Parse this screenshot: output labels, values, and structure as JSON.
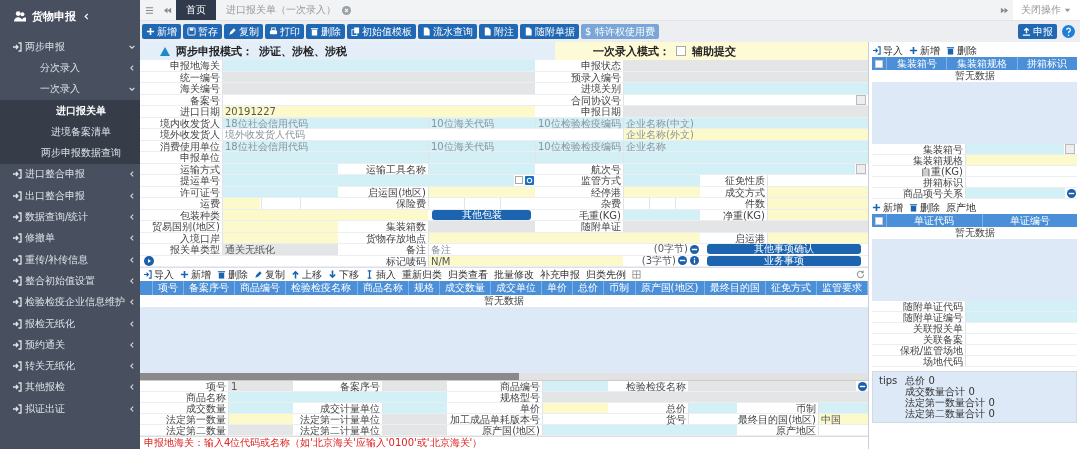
{
  "sidebar": {
    "header": {
      "label": "货物申报"
    },
    "items": [
      {
        "label": "两步申报",
        "expanded": true,
        "selected": false,
        "children": [
          {
            "label": "分次录入",
            "expanded": false,
            "selected": false
          },
          {
            "label": "一次录入",
            "expanded": true,
            "selected": false,
            "children": [
              {
                "label": "进口报关单",
                "selected": true
              },
              {
                "label": "进境备案清单",
                "selected": false
              },
              {
                "label": "两步申报数据查询",
                "selected": false
              }
            ]
          }
        ]
      },
      {
        "label": "进口整合申报",
        "expanded": false,
        "selected": false
      },
      {
        "label": "出口整合申报",
        "expanded": false,
        "selected": false
      },
      {
        "label": "数据查询/统计",
        "expanded": false,
        "selected": false
      },
      {
        "label": "修撤单",
        "expanded": false,
        "selected": false
      },
      {
        "label": "重传/补传信息",
        "expanded": false,
        "selected": false
      },
      {
        "label": "整合初始值设置",
        "expanded": false,
        "selected": false
      },
      {
        "label": "检验检疫企业信息维护",
        "expanded": false,
        "selected": false
      },
      {
        "label": "报检无纸化",
        "expanded": false,
        "selected": false
      },
      {
        "label": "预约通关",
        "expanded": false,
        "selected": false
      },
      {
        "label": "转关无纸化",
        "expanded": false,
        "selected": false
      },
      {
        "label": "其他报检",
        "expanded": false,
        "selected": false
      },
      {
        "label": "拟证出证",
        "expanded": false,
        "selected": false
      }
    ]
  },
  "tabs": [
    {
      "label": "首页",
      "selected": true,
      "closable": false
    },
    {
      "label": "进口报关单（一次录入）",
      "selected": false,
      "closable": true
    }
  ],
  "close_menu": "关闭操作",
  "toolbar": [
    {
      "label": "新增",
      "disabled": false
    },
    {
      "label": "暂存",
      "disabled": false
    },
    {
      "label": "复制",
      "disabled": false
    },
    {
      "label": "打印",
      "disabled": false
    },
    {
      "label": "删除",
      "disabled": false
    },
    {
      "label": "初始值模板",
      "disabled": false
    },
    {
      "label": "流水查询",
      "disabled": false
    },
    {
      "label": "附注",
      "disabled": false
    },
    {
      "label": "随附单据",
      "disabled": false
    },
    {
      "label": "$ 特许权使用费",
      "disabled": true
    }
  ],
  "submit_button": "申报",
  "form": {
    "banner": {
      "mode": "两步申报模式：",
      "scope": "涉证、涉检、涉税",
      "once_mode": "一次录入模式：",
      "assist": {
        "label": "辅助提交",
        "checked": false
      }
    },
    "rows": [
      [
        {
          "kind": "label",
          "text": "申报地海关"
        },
        {
          "kind": "input",
          "field": {
            "kind": "required"
          }
        },
        {
          "kind": "label",
          "text": "申报状态"
        },
        {
          "kind": "input",
          "field": {
            "kind": "readonly"
          }
        }
      ],
      [
        {
          "kind": "label",
          "text": "统一编号"
        },
        {
          "kind": "input",
          "field": {
            "kind": "readonly"
          }
        },
        {
          "kind": "label",
          "text": "预录入编号"
        },
        {
          "kind": "input",
          "field": {
            "kind": "readonly"
          }
        }
      ],
      [
        {
          "kind": "label",
          "text": "海关编号"
        },
        {
          "kind": "input",
          "field": {
            "kind": "readonly"
          }
        },
        {
          "kind": "label",
          "text": "进境关别"
        },
        {
          "kind": "input",
          "field": {
            "kind": "required"
          }
        }
      ],
      [
        {
          "kind": "label",
          "text": "备案号"
        },
        {
          "kind": "input",
          "field": {
            "kind": "plain"
          }
        },
        {
          "kind": "label",
          "text": "合同协议号"
        },
        {
          "kind": "picker",
          "field": {
            "kind": "plain"
          }
        }
      ],
      [
        {
          "kind": "label",
          "text": "进口日期"
        },
        {
          "kind": "input",
          "field": {
            "kind": "highlight",
            "value": "20191227"
          }
        },
        {
          "kind": "label",
          "text": "申报日期"
        },
        {
          "kind": "input",
          "field": {
            "kind": "readonly"
          }
        }
      ],
      [
        {
          "kind": "label",
          "text": "境内收发货人"
        },
        {
          "kind": "input",
          "field": {
            "kind": "required",
            "placeholder": "18位社会信用代码"
          }
        },
        {
          "kind": "input",
          "field": {
            "kind": "required",
            "placeholder": "10位海关代码"
          }
        },
        {
          "kind": "input",
          "field": {
            "kind": "required",
            "placeholder": "10位检验检疫编码"
          }
        },
        {
          "kind": "input",
          "field": {
            "kind": "required",
            "placeholder": "企业名称(中文)"
          }
        }
      ],
      [
        {
          "kind": "label",
          "text": "境外收发货人"
        },
        {
          "kind": "input",
          "field": {
            "kind": "plain",
            "placeholder": "境外收发货人代码"
          }
        },
        {
          "kind": "input",
          "field": {
            "kind": "highlight",
            "placeholder": "企业名称(外文)"
          }
        }
      ],
      [
        {
          "kind": "label",
          "text": "消费使用单位"
        },
        {
          "kind": "input",
          "field": {
            "kind": "required",
            "placeholder": "18位社会信用代码"
          }
        },
        {
          "kind": "input",
          "field": {
            "kind": "required",
            "placeholder": "10位海关代码"
          }
        },
        {
          "kind": "input",
          "field": {
            "kind": "required",
            "placeholder": "10位检验检疫编码"
          }
        },
        {
          "kind": "input",
          "field": {
            "kind": "required",
            "placeholder": "企业名称"
          }
        }
      ],
      [
        {
          "kind": "label",
          "text": "申报单位"
        },
        {
          "kind": "input",
          "field": {
            "kind": "required"
          }
        },
        {
          "kind": "input",
          "field": {
            "kind": "required"
          }
        },
        {
          "kind": "input",
          "field": {
            "kind": "required"
          }
        },
        {
          "kind": "input",
          "field": {
            "kind": "required"
          }
        }
      ],
      [
        {
          "kind": "label",
          "text": "运输方式"
        },
        {
          "kind": "input",
          "field": {
            "kind": "required"
          }
        },
        {
          "kind": "label",
          "text": "运输工具名称"
        },
        {
          "kind": "input",
          "field": {
            "kind": "required"
          }
        },
        {
          "kind": "label",
          "text": "航次号"
        },
        {
          "kind": "picker",
          "field": {
            "kind": "required"
          }
        }
      ],
      [
        {
          "kind": "label",
          "text": "提运单号"
        },
        {
          "kind": "check-input",
          "checked": false,
          "field": {
            "kind": "required"
          }
        },
        {
          "kind": "label",
          "text": "监管方式"
        },
        {
          "kind": "input",
          "field": {
            "kind": "required"
          }
        },
        {
          "kind": "label",
          "text": "征免性质"
        },
        {
          "kind": "input",
          "field": {
            "kind": "plain"
          }
        }
      ],
      [
        {
          "kind": "label",
          "text": "许可证号"
        },
        {
          "kind": "input",
          "field": {
            "kind": "required"
          }
        },
        {
          "kind": "label",
          "text": "启运国(地区)"
        },
        {
          "kind": "input",
          "field": {
            "kind": "highlight"
          }
        },
        {
          "kind": "label",
          "text": "经停港"
        },
        {
          "kind": "input",
          "field": {
            "kind": "highlight"
          }
        },
        {
          "kind": "label",
          "text": "成交方式"
        },
        {
          "kind": "input",
          "field": {
            "kind": "highlight"
          }
        }
      ],
      [
        {
          "kind": "label",
          "text": "运费"
        },
        {
          "kind": "split",
          "parts": [
            {
              "kind": "highlight"
            },
            {
              "kind": "plain"
            },
            {
              "kind": "plain"
            }
          ]
        },
        {
          "kind": "label",
          "text": "保险费"
        },
        {
          "kind": "split",
          "parts": [
            {
              "kind": "plain"
            },
            {
              "kind": "plain"
            },
            {
              "kind": "plain"
            }
          ]
        },
        {
          "kind": "label",
          "text": "杂费"
        },
        {
          "kind": "split",
          "parts": [
            {
              "kind": "plain"
            },
            {
              "kind": "plain"
            },
            {
              "kind": "plain"
            }
          ]
        },
        {
          "kind": "label",
          "text": "件数"
        },
        {
          "kind": "input",
          "field": {
            "kind": "highlight"
          }
        }
      ],
      [
        {
          "kind": "label",
          "text": "包装种类"
        },
        {
          "kind": "input",
          "field": {
            "kind": "highlight"
          }
        },
        {
          "kind": "button",
          "text": "其他包装"
        },
        {
          "kind": "label",
          "text": "毛重(KG)"
        },
        {
          "kind": "input",
          "field": {
            "kind": "required"
          }
        },
        {
          "kind": "label",
          "text": "净重(KG)"
        },
        {
          "kind": "input",
          "field": {
            "kind": "highlight"
          }
        }
      ],
      [
        {
          "kind": "label",
          "text": "贸易国别(地区)"
        },
        {
          "kind": "input",
          "field": {
            "kind": "highlight"
          }
        },
        {
          "kind": "label",
          "text": "集装箱数"
        },
        {
          "kind": "input",
          "field": {
            "kind": "readonly"
          }
        },
        {
          "kind": "label",
          "text": "随附单证"
        },
        {
          "kind": "input",
          "field": {
            "kind": "readonly"
          }
        }
      ],
      [
        {
          "kind": "label",
          "text": "入境口岸"
        },
        {
          "kind": "input",
          "field": {
            "kind": "highlight"
          }
        },
        {
          "kind": "label",
          "text": "货物存放地点"
        },
        {
          "kind": "input",
          "field": {
            "kind": "highlight"
          }
        },
        {
          "kind": "label",
          "text": "启运港"
        },
        {
          "kind": "input",
          "field": {
            "kind": "highlight"
          }
        }
      ],
      [
        {
          "kind": "label",
          "text": "报关单类型"
        },
        {
          "kind": "input",
          "field": {
            "kind": "readonly",
            "value": "通关无纸化"
          }
        },
        {
          "kind": "label",
          "text": "备注"
        },
        {
          "kind": "input",
          "field": {
            "kind": "plain",
            "placeholder": "备注"
          }
        },
        {
          "kind": "note",
          "text": "(0字节)"
        },
        {
          "kind": "button",
          "text": "其他事项确认"
        }
      ],
      [
        {
          "kind": "play"
        },
        {
          "kind": "blank"
        },
        {
          "kind": "label",
          "text": "标记唛码"
        },
        {
          "kind": "input",
          "field": {
            "kind": "highlight",
            "value": "N/M"
          }
        },
        {
          "kind": "note-info",
          "text": "(3字节)"
        },
        {
          "kind": "button",
          "text": "业务事项"
        }
      ]
    ]
  },
  "goods_toolbar": [
    "导入",
    "新增",
    "删除",
    "复制",
    "上移",
    "下移",
    "插入",
    "重新归类",
    "归类查看",
    "批量修改",
    "补充申报",
    "归类先例"
  ],
  "goods_table": {
    "columns": [
      "项号",
      "备案序号",
      "商品编号",
      "检验检疫名称",
      "商品名称",
      "规格",
      "成交数量",
      "成交单位",
      "单价",
      "总价",
      "币制",
      "原产国(地区)",
      "最终目的国",
      "征免方式",
      "监管要求"
    ],
    "empty_text": "暂无数据"
  },
  "item_form": {
    "fields": [
      {
        "kind": "label",
        "text": "项号"
      },
      {
        "kind": "input",
        "field": {
          "kind": "readonly",
          "value": "1"
        }
      },
      {
        "kind": "label",
        "text": "备案序号"
      },
      {
        "kind": "input",
        "field": {
          "kind": "readonly"
        }
      },
      {
        "kind": "label",
        "text": "商品编号"
      },
      {
        "kind": "input",
        "field": {
          "kind": "required"
        }
      },
      {
        "kind": "label",
        "text": "检验检疫名称"
      },
      {
        "kind": "lookup",
        "field": {
          "kind": "readonly"
        }
      },
      {
        "kind": "label",
        "text": "商品名称"
      },
      {
        "kind": "input",
        "field": {
          "kind": "required"
        }
      },
      {
        "kind": "label",
        "text": "规格型号"
      },
      {
        "kind": "input",
        "field": {
          "kind": "readonly"
        }
      },
      {
        "kind": "label",
        "text": "成交数量"
      },
      {
        "kind": "input",
        "field": {
          "kind": "required"
        }
      },
      {
        "kind": "label",
        "text": "成交计量单位"
      },
      {
        "kind": "input",
        "field": {
          "kind": "required"
        }
      },
      {
        "kind": "label",
        "text": "单价"
      },
      {
        "kind": "input",
        "field": {
          "kind": "highlight"
        }
      },
      {
        "kind": "label",
        "text": "总价"
      },
      {
        "kind": "input",
        "field": {
          "kind": "required"
        }
      },
      {
        "kind": "label",
        "text": "币制"
      },
      {
        "kind": "input",
        "field": {
          "kind": "required"
        }
      },
      {
        "kind": "label",
        "text": "法定第一数量"
      },
      {
        "kind": "input",
        "field": {
          "kind": "highlight"
        }
      },
      {
        "kind": "label",
        "text": "法定第一计量单位"
      },
      {
        "kind": "input",
        "field": {
          "kind": "readonly"
        }
      },
      {
        "kind": "label",
        "text": "加工成品单耗版本号"
      },
      {
        "kind": "input",
        "field": {
          "kind": "plain"
        }
      },
      {
        "kind": "label",
        "text": "货号"
      },
      {
        "kind": "input",
        "field": {
          "kind": "plain"
        }
      },
      {
        "kind": "label",
        "text": "最终目的国(地区)"
      },
      {
        "kind": "input",
        "field": {
          "kind": "highlight",
          "value": "中国"
        }
      },
      {
        "kind": "label",
        "text": "法定第二数量"
      },
      {
        "kind": "input",
        "field": {
          "kind": "readonly"
        }
      },
      {
        "kind": "label",
        "text": "法定第二计量单位"
      },
      {
        "kind": "input",
        "field": {
          "kind": "readonly"
        }
      },
      {
        "kind": "label",
        "text": "原产国(地区)"
      },
      {
        "kind": "input",
        "field": {
          "kind": "required"
        }
      },
      {
        "kind": "label",
        "text": "原产地区"
      },
      {
        "kind": "input",
        "field": {
          "kind": "plain"
        }
      }
    ]
  },
  "status_hint": "申报地海关：输入4位代码或名称（如'北京海关'应输入'0100'或'北京海关'）",
  "container_panel": {
    "toolbar": [
      "导入",
      "新增",
      "删除"
    ],
    "select_all": {
      "checked": false
    },
    "columns": [
      "集装箱号",
      "集装箱规格",
      "拼箱标识"
    ],
    "empty_text": "暂无数据",
    "fields": [
      [
        {
          "kind": "label",
          "text": "集装箱号"
        },
        {
          "kind": "picker",
          "field": {
            "kind": "required"
          }
        }
      ],
      [
        {
          "kind": "label",
          "text": "集装箱规格"
        },
        {
          "kind": "input",
          "field": {
            "kind": "highlight"
          }
        }
      ],
      [
        {
          "kind": "label",
          "text": "自重(KG)"
        },
        {
          "kind": "input",
          "field": {
            "kind": "plain"
          }
        }
      ],
      [
        {
          "kind": "label",
          "text": "拼箱标识"
        },
        {
          "kind": "input",
          "field": {
            "kind": "plain"
          }
        }
      ],
      [
        {
          "kind": "label",
          "text": "商品项号关系"
        },
        {
          "kind": "lookup",
          "field": {
            "kind": "required"
          }
        }
      ]
    ]
  },
  "documents_panel": {
    "toolbar": [
      "新增",
      "删除",
      "原产地"
    ],
    "select_all": {
      "checked": false
    },
    "columns": [
      "单证代码",
      "单证编号"
    ],
    "empty_text": "暂无数据",
    "fields": [
      [
        {
          "kind": "label",
          "text": "随附单证代码"
        },
        {
          "kind": "input",
          "field": {
            "kind": "required"
          }
        }
      ],
      [
        {
          "kind": "label",
          "text": "随附单证编号"
        },
        {
          "kind": "input",
          "field": {
            "kind": "required"
          }
        }
      ],
      [
        {
          "kind": "label",
          "text": "关联报关单"
        },
        {
          "kind": "input",
          "field": {
            "kind": "plain"
          }
        }
      ],
      [
        {
          "kind": "label",
          "text": "关联备案"
        },
        {
          "kind": "input",
          "field": {
            "kind": "plain"
          }
        }
      ],
      [
        {
          "kind": "label",
          "text": "保税/监管场地"
        },
        {
          "kind": "input",
          "field": {
            "kind": "plain"
          }
        }
      ],
      [
        {
          "kind": "label",
          "text": "场地代码"
        },
        {
          "kind": "input",
          "field": {
            "kind": "plain"
          }
        }
      ]
    ]
  },
  "tips": {
    "label": "tips",
    "lines": [
      "总价  0",
      "成交数量合计  0",
      "法定第一数量合计  0",
      "法定第二数量合计  0"
    ]
  }
}
